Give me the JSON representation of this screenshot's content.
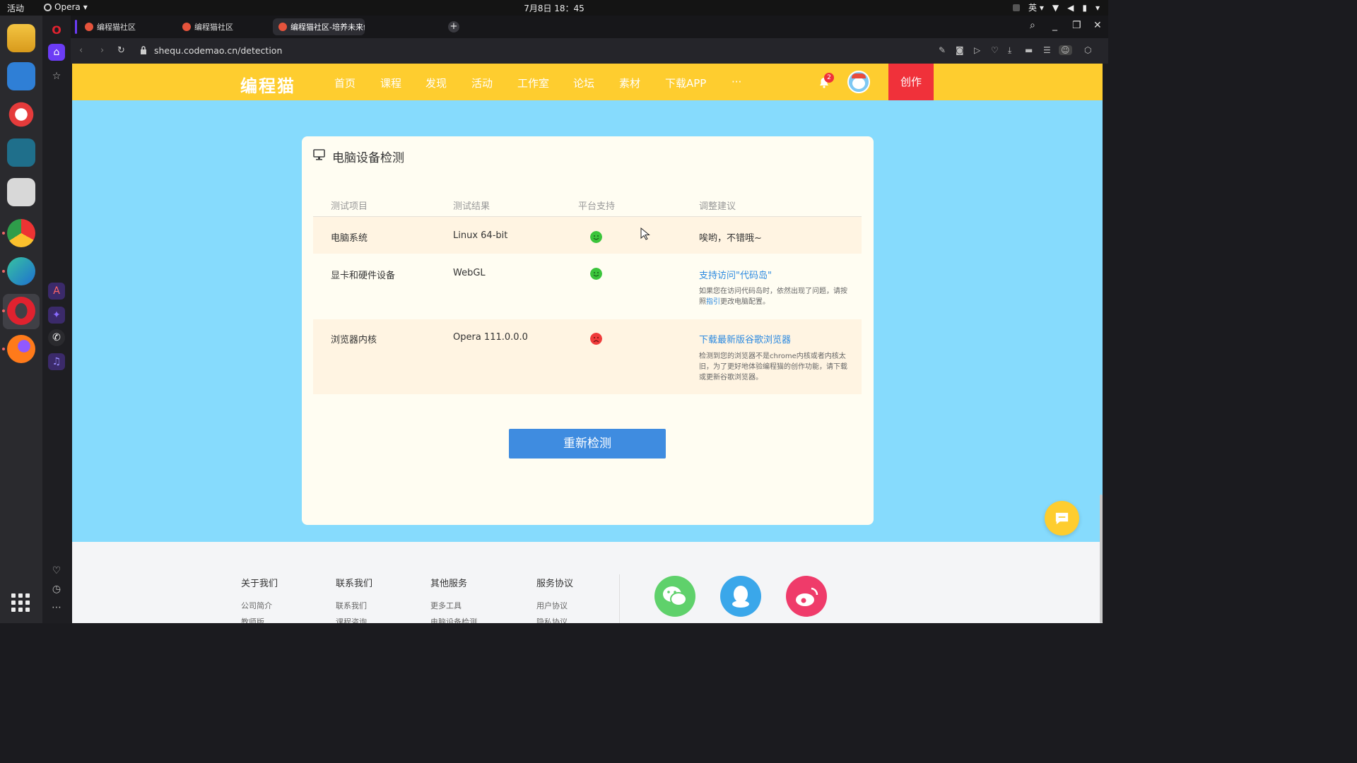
{
  "topbar": {
    "activities": "活动",
    "app_name": "Opera",
    "clock": "7月8日  18：45",
    "input_method": "英"
  },
  "browser": {
    "tabs": [
      {
        "label": "编程猫社区"
      },
      {
        "label": "编程猫社区"
      },
      {
        "label": "编程猫社区-培养未来创"
      }
    ],
    "url": "shequ.codemao.cn/detection"
  },
  "site": {
    "logo": "编程猫",
    "nav": [
      "首页",
      "课程",
      "发现",
      "活动",
      "工作室",
      "论坛",
      "素材",
      "下载APP",
      "···"
    ],
    "notification_count": "2",
    "create_label": "创作"
  },
  "detection": {
    "title": "电脑设备检测",
    "columns": [
      "测试项目",
      "测试结果",
      "平台支持",
      "调整建议"
    ],
    "rows": [
      {
        "item": "电脑系统",
        "result": "Linux 64-bit",
        "support": "ok",
        "advice": "唉哟，不错哦~"
      },
      {
        "item": "显卡和硬件设备",
        "result": "WebGL",
        "support": "ok",
        "advice_link": "支持访问\"代码岛\"",
        "note_a": "如果您在访问代码岛时，依然出现了问题，请按照",
        "note_link": "指引",
        "note_b": "更改电脑配置。"
      },
      {
        "item": "浏览器内核",
        "result": "Opera 111.0.0.0",
        "support": "bad",
        "advice_link": "下载最新版谷歌浏览器",
        "note": "检测到您的浏览器不是chrome内核或者内核太旧，为了更好地体验编程猫的创作功能，请下载或更新谷歌浏览器。"
      }
    ],
    "recheck_label": "重新检测"
  },
  "footer": {
    "columns": [
      {
        "heading": "关于我们",
        "links": [
          "公司简介",
          "教师版"
        ]
      },
      {
        "heading": "联系我们",
        "links": [
          "联系我们",
          "课程咨询"
        ]
      },
      {
        "heading": "其他服务",
        "links": [
          "更多工具",
          "电脑设备检测"
        ]
      },
      {
        "heading": "服务协议",
        "links": [
          "用户协议",
          "隐私协议"
        ]
      }
    ]
  },
  "colors": {
    "brand_yellow": "#fecd2f",
    "create_red": "#f0313a",
    "page_blue": "#86dbfd",
    "ok_green": "#3bc43b",
    "bad_red": "#ef3b3b",
    "link_blue": "#2d8ae0"
  }
}
